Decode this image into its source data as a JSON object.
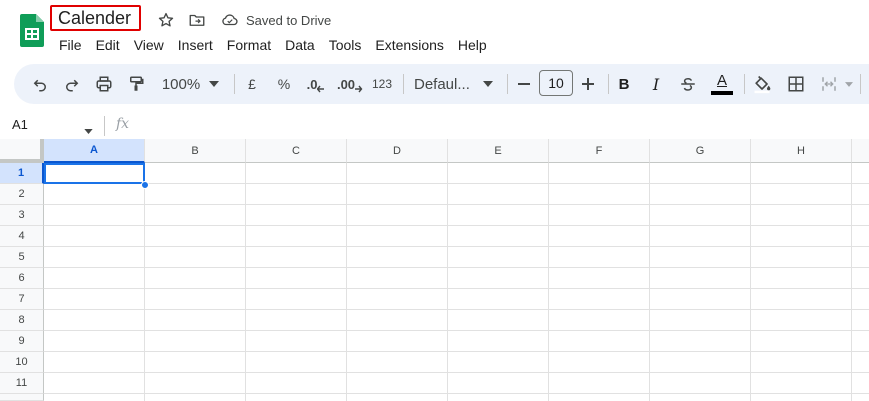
{
  "app": {
    "document_title": "Calender",
    "save_status": "Saved to Drive",
    "accent_color": "#0b57d0",
    "highlight_color": "#e00000"
  },
  "menu": {
    "items": [
      "File",
      "Edit",
      "View",
      "Insert",
      "Format",
      "Data",
      "Tools",
      "Extensions",
      "Help"
    ]
  },
  "toolbar": {
    "zoom": "100%",
    "currency": "£",
    "percent": "%",
    "decrease_decimal": ".0",
    "increase_decimal": ".00",
    "number_format": "123",
    "font_family": "Defaul...",
    "font_size": "10",
    "bold": "B",
    "italic": "I",
    "text_color": "A"
  },
  "formula_bar": {
    "cell_reference": "A1",
    "fx_label": "fx",
    "content": ""
  },
  "sheet": {
    "columns": [
      "A",
      "B",
      "C",
      "D",
      "E",
      "F",
      "G",
      "H"
    ],
    "rows": [
      "1",
      "2",
      "3",
      "4",
      "5",
      "6",
      "7",
      "8",
      "9",
      "10",
      "11"
    ],
    "selected_cell": "A1"
  }
}
